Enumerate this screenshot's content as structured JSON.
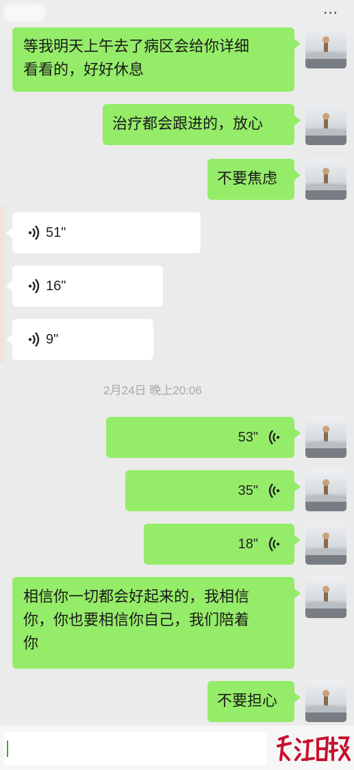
{
  "header": {
    "more_icon": "more-dots-icon",
    "more_glyph": "···"
  },
  "messages": [
    {
      "type": "text",
      "side": "me",
      "text_lines": [
        "等我明天上午去了病区会给你详细",
        "看看的，好好休息"
      ]
    },
    {
      "type": "text",
      "side": "me",
      "text": "治疗都会跟进的，放心"
    },
    {
      "type": "text",
      "side": "me",
      "text": "不要焦虑"
    },
    {
      "type": "voice",
      "side": "other",
      "duration": "51\""
    },
    {
      "type": "voice",
      "side": "other",
      "duration": "16\""
    },
    {
      "type": "voice",
      "side": "other",
      "duration": "9\""
    },
    {
      "type": "timestamp",
      "text": "2月24日 晚上20:06"
    },
    {
      "type": "voice",
      "side": "me",
      "duration": "53\""
    },
    {
      "type": "voice",
      "side": "me",
      "duration": "35\""
    },
    {
      "type": "voice",
      "side": "me",
      "duration": "18\""
    },
    {
      "type": "text",
      "side": "me",
      "text_lines": [
        "相信你一切都会好起来的，我相信",
        "你，你也要相信你自己，我们陪着",
        "你"
      ]
    },
    {
      "type": "text",
      "side": "me",
      "text": "不要担心"
    }
  ],
  "input": {
    "value": ""
  },
  "colors": {
    "background": "#ebebeb",
    "my_bubble": "#95ec69",
    "other_bubble": "#ffffff",
    "timestamp": "#a8a8a8",
    "watermark": "#c8102e"
  },
  "icons": [
    "avatar",
    "voice-wave-icon",
    "more-dots-icon",
    "newspaper-logo"
  ]
}
